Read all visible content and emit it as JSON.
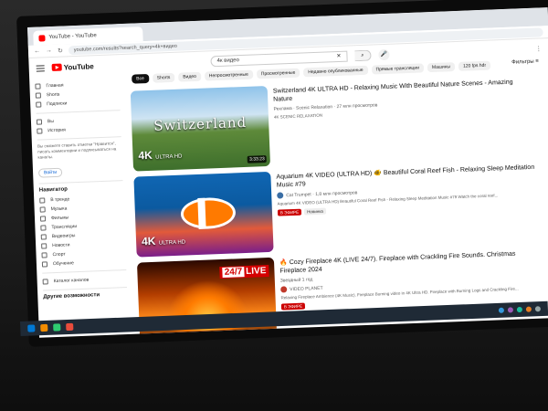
{
  "browser": {
    "tab_title": "YouTube - YouTube",
    "url": "youtube.com/results?search_query=4k+видео"
  },
  "header": {
    "logo_text": "YouTube",
    "search_value": "4к видео",
    "search_btn": "⌕",
    "mic": "🎤"
  },
  "chips": [
    "Все",
    "Shorts",
    "Видео",
    "Непросмотренные",
    "Просмотренные",
    "Недавно опубликованные",
    "Прямые трансляции",
    "Машины",
    "120 fps hdr"
  ],
  "filters_label": "Фильтры",
  "sidebar": {
    "items_top": [
      "Главная",
      "Shorts",
      "Подписки"
    ],
    "items_you": [
      "Вы",
      "История"
    ],
    "note": "Вы сможете ставить отметки \"Нравится\", писать комментарии и подписываться на каналы.",
    "signin": "Войти",
    "section_title": "Навигатор",
    "nav_items": [
      "В тренде",
      "Музыка",
      "Фильмы",
      "Трансляции",
      "Видеоигры",
      "Новости",
      "Спорт",
      "Обучение"
    ],
    "footer_items": [
      "Каталог каналов"
    ],
    "more_title": "Другие возможности"
  },
  "videos": [
    {
      "title": "Switzerland 4K ULTRA HD - Relaxing Music With Beautiful Nature Scenes - Amazing Nature",
      "channel": "Реклама · Scenic Relaxation · 27 млн просмотров",
      "desc": "4K SCENIC RELAXATION",
      "thumb_text": "Switzerland",
      "badge": "4K",
      "badge_sub": "ULTRA HD",
      "duration": "3:33:23"
    },
    {
      "title": "Aquarium 4K VIDEO (ULTRA HD) 🐠 Beautiful Coral Reef Fish - Relaxing Sleep Meditation Music #79",
      "channel": "Cat Trumpet · 1,8 млн просмотров",
      "desc": "Aquarium 4K VIDEO (ULTRA HD) Beautiful Coral Reef Fish - Relaxing Sleep Meditation Music #79 Watch the coral reef...",
      "badge": "4K",
      "badge_sub": "ULTRA HD",
      "live": "В ЭФИРЕ",
      "new": "Новинка"
    },
    {
      "title": "🔥 Cozy Fireplace 4K (LIVE 24/7). Fireplace with Crackling Fire Sounds. Christmas Fireplace 2024",
      "channel": "VIDEO PLANET",
      "meta2": "Звездный 1 год",
      "desc": "Relaxing Fireplace Ambience (4K Music). Fireplace Burning video in 4K Ultra HD. Fireplace with Burning Logs and Crackling Fire...",
      "live_badge": "24/7",
      "live_word": "LIVE",
      "live": "В ЭФИРЕ"
    }
  ]
}
